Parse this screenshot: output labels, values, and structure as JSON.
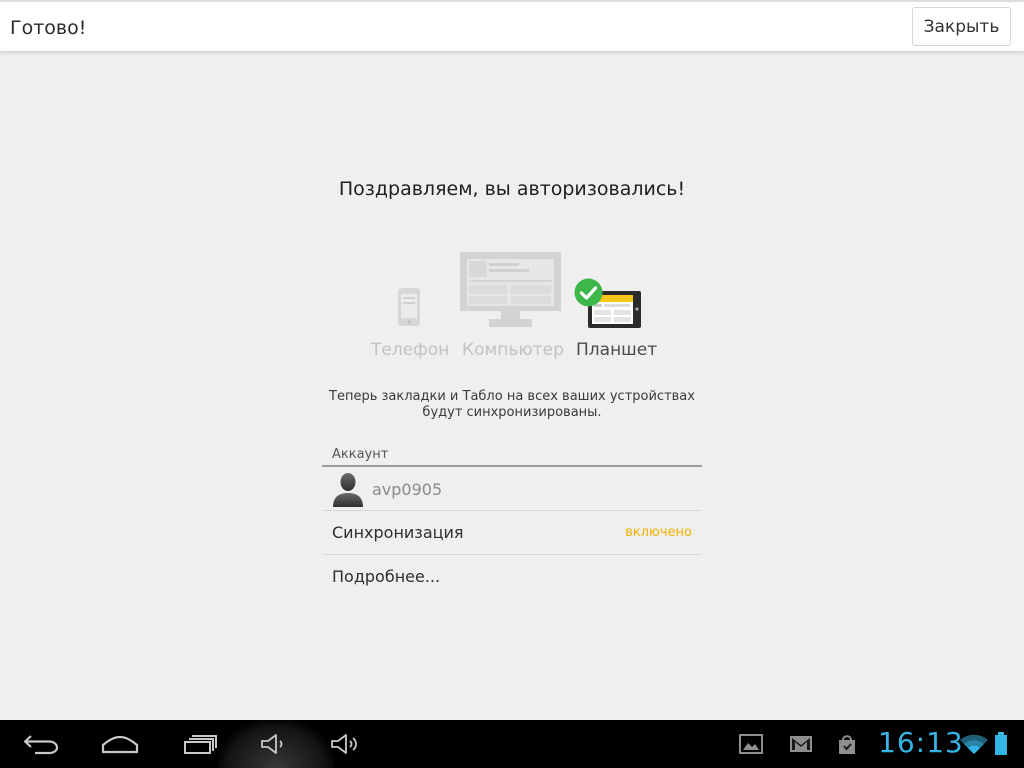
{
  "topbar": {
    "title": "Готово!",
    "close_label": "Закрыть"
  },
  "main": {
    "headline": "Поздравляем, вы авторизовались!",
    "devices": [
      {
        "label": "Телефон",
        "icon": "phone-icon",
        "active": false
      },
      {
        "label": "Компьютер",
        "icon": "monitor-icon",
        "active": false
      },
      {
        "label": "Планшет",
        "icon": "tablet-icon",
        "active": true,
        "checked": true
      }
    ],
    "description_line1": "Теперь закладки и Табло на всех ваших устройствах",
    "description_line2": "будут синхронизированы.",
    "account_section_label": "Аккаунт",
    "account_name": "avp0905",
    "sync_label": "Синхронизация",
    "sync_status": "включено",
    "more_label": "Подробнее..."
  },
  "navbar": {
    "clock": "16:13",
    "icons": [
      "back-icon",
      "home-icon",
      "recent-apps-icon",
      "volume-down-icon",
      "volume-up-icon",
      "gallery-icon",
      "gmail-icon",
      "play-store-icon",
      "wifi-icon",
      "battery-icon"
    ]
  },
  "colors": {
    "accent_sync": "#f0b400",
    "check_green": "#3db64a",
    "clock_blue": "#33b5e5",
    "tablet_yellow": "#f5c518"
  }
}
